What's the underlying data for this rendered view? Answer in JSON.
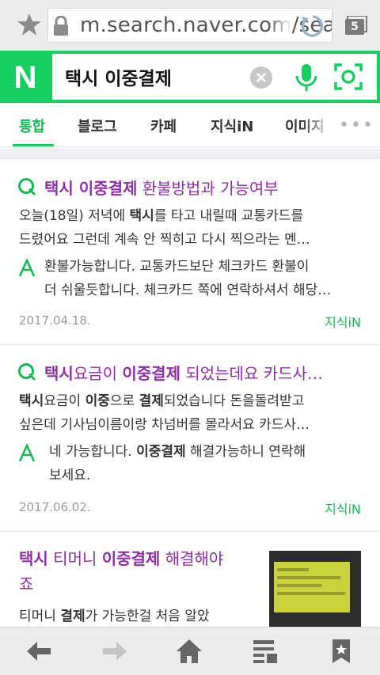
{
  "browser": {
    "url": "m.search.naver.com/search",
    "tab_count": "5"
  },
  "search": {
    "logo": "N",
    "query": "택시 이중결제"
  },
  "tabs": [
    {
      "label": "통합",
      "active": true
    },
    {
      "label": "블로그"
    },
    {
      "label": "카페"
    },
    {
      "label": "지식iN"
    },
    {
      "label": "이미지"
    }
  ],
  "results": [
    {
      "title_bold": "택시 이중결제",
      "title_rest": " 환불방법과 가능여부",
      "snippet": [
        [
          [
            "오늘(18일) 저녁에 ",
            false
          ],
          [
            "택시",
            true
          ],
          [
            "를 타고 내릴때 교통카드를",
            false
          ]
        ],
        [
          [
            "드렸어요 그런데 계속 안 찍히고 다시 찍으라는 멘…",
            false
          ]
        ]
      ],
      "answer": [
        [
          [
            "환불가능합니다. 교통카드보단 체크카드 환불이",
            false
          ]
        ],
        [
          [
            "더 쉬울듯합니다. 체크카드 쪽에 연락하셔서 해당…",
            false
          ]
        ]
      ],
      "date": "2017.04.18.",
      "source": "지식iN"
    },
    {
      "title_parts": [
        [
          "택시",
          true
        ],
        [
          "요금이 ",
          false
        ],
        [
          "이중결제",
          true
        ],
        [
          " 되었는데요 카드사…",
          false
        ]
      ],
      "snippet": [
        [
          [
            "택시",
            true
          ],
          [
            "요금이 ",
            false
          ],
          [
            "이중",
            true
          ],
          [
            "으로 ",
            false
          ],
          [
            "결제",
            true
          ],
          [
            "되었습니다 돈을돌려받고",
            false
          ]
        ],
        [
          [
            "싶은데 기사님이름이랑 차넘버를 몰라서요 카드사…",
            false
          ]
        ]
      ],
      "answer": [
        [
          [
            "네 가능합니다. ",
            false
          ],
          [
            "이중결제",
            true
          ],
          [
            " 해결가능하니 연락해",
            false
          ]
        ],
        [
          [
            "보세요.",
            false
          ]
        ]
      ],
      "date": "2017.06.02.",
      "source": "지식iN"
    },
    {
      "title_line1": [
        [
          "택시",
          true
        ],
        [
          " 티머니 ",
          false
        ],
        [
          "이중결제",
          true
        ],
        [
          " 해결해야",
          false
        ]
      ],
      "title_line2": "죠",
      "snippet": [
        [
          "티머니 ",
          false
        ],
        [
          "결제",
          true
        ],
        [
          "가 가능한걸 처음 알았",
          false
        ]
      ],
      "thumb_text": [
        "[Web발신]",
        "신한카드승인 노*수(6*0*)",
        "09/15 23:26",
        "(일시불)3,300원 티머니택시"
      ]
    }
  ],
  "icons": {
    "bookmark_star": "star-icon",
    "lock": "lock-icon",
    "reload": "reload-icon",
    "clear": "clear-icon",
    "mic": "mic-icon",
    "lens": "lens-icon",
    "question": "question-icon",
    "answer": "answer-icon",
    "back": "back-arrow-icon",
    "forward": "forward-arrow-icon",
    "home": "home-icon",
    "reader": "reader-icon",
    "bookmarks": "bookmark-icon"
  },
  "colors": {
    "naver_green": "#19ce60",
    "title_purple": "#8e2fa8",
    "source_green": "#19b756"
  }
}
